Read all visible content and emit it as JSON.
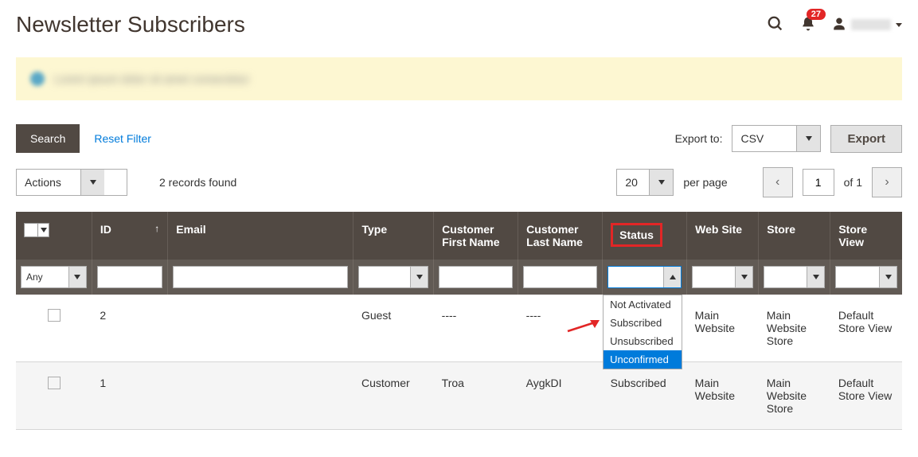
{
  "header": {
    "title": "Newsletter Subscribers",
    "notification_count": "27"
  },
  "toolbar": {
    "search_label": "Search",
    "reset_filter_label": "Reset Filter",
    "export_to_label": "Export to:",
    "export_format": "CSV",
    "export_button": "Export",
    "actions_label": "Actions",
    "records_found": "2 records found",
    "page_size": "20",
    "per_page_label": "per page",
    "current_page": "1",
    "of_label": "of 1"
  },
  "columns": {
    "id": "ID",
    "email": "Email",
    "type": "Type",
    "first_name": "Customer First Name",
    "last_name": "Customer Last Name",
    "status": "Status",
    "website": "Web Site",
    "store": "Store",
    "store_view": "Store View"
  },
  "filters": {
    "checkbox_select": "Any",
    "status_options": [
      "Not Activated",
      "Subscribed",
      "Unsubscribed",
      "Unconfirmed"
    ],
    "status_selected": "Unconfirmed"
  },
  "rows": [
    {
      "id": "2",
      "email": "",
      "type": "Guest",
      "first_name": "----",
      "last_name": "----",
      "status": "",
      "website": "Main Website",
      "store": "Main Website Store",
      "store_view": "Default Store View"
    },
    {
      "id": "1",
      "email": "",
      "type": "Customer",
      "first_name": "Troa",
      "last_name": "AygkDI",
      "status": "Subscribed",
      "website": "Main Website",
      "store": "Main Website Store",
      "store_view": "Default Store View"
    }
  ]
}
